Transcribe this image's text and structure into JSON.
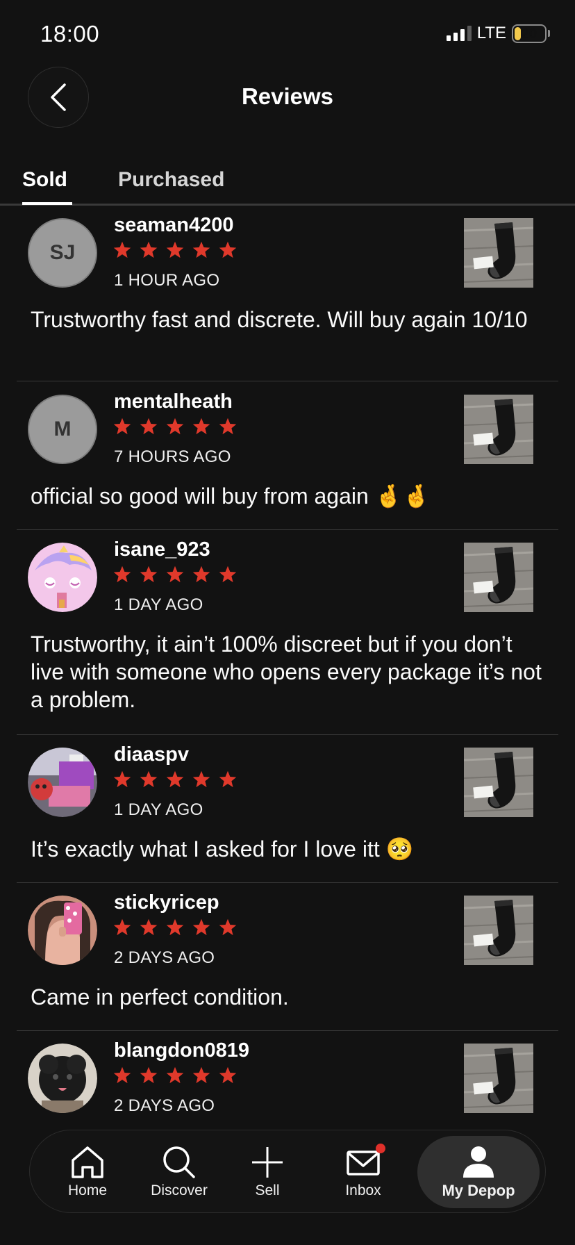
{
  "status_bar": {
    "time": "18:00",
    "network": "LTE",
    "battery": "20"
  },
  "header": {
    "title": "Reviews"
  },
  "tabs": [
    {
      "label": "Sold",
      "active": true
    },
    {
      "label": "Purchased",
      "active": false
    }
  ],
  "reviews": [
    {
      "avatar_initials": "SJ",
      "username": "seaman4200",
      "rating": 5,
      "time": "1 HOUR AGO",
      "text": "Trustworthy fast and discrete. Will buy again 10/10"
    },
    {
      "avatar_initials": "M",
      "username": "mentalheath",
      "rating": 5,
      "time": "7 HOURS AGO",
      "text": "official so good will buy from again 🤞🤞"
    },
    {
      "avatar_initials": "",
      "username": "isane_923",
      "rating": 5,
      "time": "1 DAY AGO",
      "text": "Trustworthy, it ain’t 100% discreet but if you don’t live with someone who opens every package it’s not a problem."
    },
    {
      "avatar_initials": "",
      "username": "diaaspv",
      "rating": 5,
      "time": "1 DAY AGO",
      "text": "It’s exactly what I asked for I love itt 🥺"
    },
    {
      "avatar_initials": "",
      "username": "stickyricep",
      "rating": 5,
      "time": "2 DAYS AGO",
      "text": "Came in perfect condition."
    },
    {
      "avatar_initials": "",
      "username": "blangdon0819",
      "rating": 5,
      "time": "2 DAYS AGO",
      "text": ""
    }
  ],
  "nav": [
    {
      "label": "Home",
      "icon": "home-icon",
      "active": false
    },
    {
      "label": "Discover",
      "icon": "search-icon",
      "active": false
    },
    {
      "label": "Sell",
      "icon": "plus-icon",
      "active": false
    },
    {
      "label": "Inbox",
      "icon": "mail-icon",
      "active": false,
      "badge": true
    },
    {
      "label": "My Depop",
      "icon": "profile-icon",
      "active": true
    }
  ],
  "colors": {
    "background": "#121212",
    "star": "#e0392b",
    "badge": "#e0302a",
    "battery": "#f2c94c"
  }
}
